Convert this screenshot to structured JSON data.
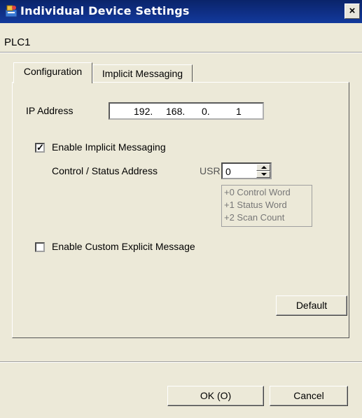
{
  "window": {
    "title": "Individual Device Settings",
    "close_label": "×"
  },
  "device": {
    "name": "PLC1"
  },
  "tabs": [
    {
      "label": "Configuration",
      "active": true
    },
    {
      "label": "Implicit Messaging",
      "active": false
    }
  ],
  "config": {
    "ip_label": "IP Address",
    "ip_segments": [
      "192.",
      "168.",
      "0.",
      "1"
    ],
    "enable_implicit": {
      "label": "Enable Implicit Messaging",
      "checked": true,
      "check_glyph": "✓"
    },
    "control_status": {
      "label": "Control / Status Address",
      "device_type": "USR",
      "value": "0",
      "info_lines": [
        "+0 Control Word",
        "+1 Status Word",
        "+2 Scan Count"
      ]
    },
    "enable_custom_explicit": {
      "label": "Enable Custom Explicit Message",
      "checked": false
    },
    "default_button": "Default"
  },
  "footer": {
    "ok_label": "OK (O)",
    "cancel_label": "Cancel"
  },
  "colors": {
    "titlebar": "#0a246a",
    "face": "#ece9d8"
  },
  "icons": {
    "title": "device-settings-icon",
    "close": "close-icon",
    "spin_up": "chevron-up-icon",
    "spin_down": "chevron-down-icon",
    "check": "checkmark-icon"
  }
}
